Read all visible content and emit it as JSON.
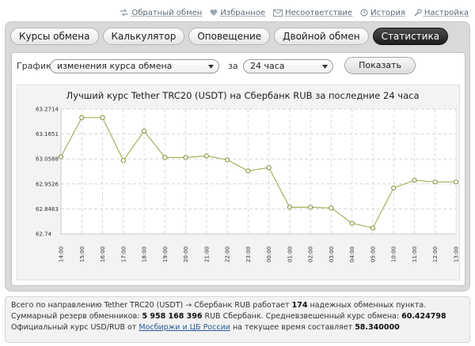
{
  "toplinks": [
    {
      "icon": "links-icon",
      "label": "Обратный обмен"
    },
    {
      "icon": "heart-icon",
      "label": "Избранное"
    },
    {
      "icon": "mail-icon",
      "label": "Несоответствие"
    },
    {
      "icon": "history-icon",
      "label": "История"
    },
    {
      "icon": "settings-icon",
      "label": "Настройка"
    }
  ],
  "tabs": [
    {
      "label": "Курсы обмена",
      "active": false
    },
    {
      "label": "Калькулятор",
      "active": false
    },
    {
      "label": "Оповещение",
      "active": false
    },
    {
      "label": "Двойной обмен",
      "active": false
    },
    {
      "label": "Статистика",
      "active": true
    }
  ],
  "controls": {
    "graph_label": "График",
    "graph_type": "изменения курса обмена",
    "period_label": "за",
    "period": "24 часа",
    "show_button": "Показать"
  },
  "chart_data": {
    "type": "line",
    "title": "Лучший курс Tether TRC20 (USDT) на Сбербанк RUB за последние 24 часа",
    "categories": [
      "14:00",
      "15:00",
      "16:00",
      "17:00",
      "18:00",
      "19:00",
      "20:00",
      "21:00",
      "22:00",
      "23:00",
      "00:00",
      "01:00",
      "02:00",
      "03:00",
      "04:00",
      "05:00",
      "10:00",
      "11:00",
      "12:00",
      "13:00"
    ],
    "values": [
      63.068,
      63.235,
      63.235,
      63.052,
      63.178,
      63.065,
      63.065,
      63.072,
      63.055,
      63.008,
      63.022,
      62.853,
      62.853,
      62.85,
      62.785,
      62.765,
      62.935,
      62.968,
      62.961,
      62.961
    ],
    "yticks": [
      "63.2714",
      "63.1651",
      "63.0588",
      "62.9526",
      "62.8463",
      "62.74"
    ],
    "ylim": [
      62.74,
      63.2714
    ],
    "grid": true,
    "color": "#a3b35b"
  },
  "info": {
    "line1_a": "Всего по направлению Tether TRC20 (USDT) → Сбербанк RUB работает",
    "line1_count": "174",
    "line1_b": "надежных обменных пункта.",
    "line2_a": "Суммарный резерв обменников:",
    "line2_reserve": "5 958 168 396",
    "line2_b": "RUB Сбербанк. Средневзвешенный курс обмена:",
    "line2_avg": "60.424798",
    "line3_a": "Официальный курс USD/RUB от",
    "line3_link": "Мосбиржи и ЦБ России",
    "line3_b": "на текущее время составляет",
    "line3_rate": "58.340000"
  }
}
